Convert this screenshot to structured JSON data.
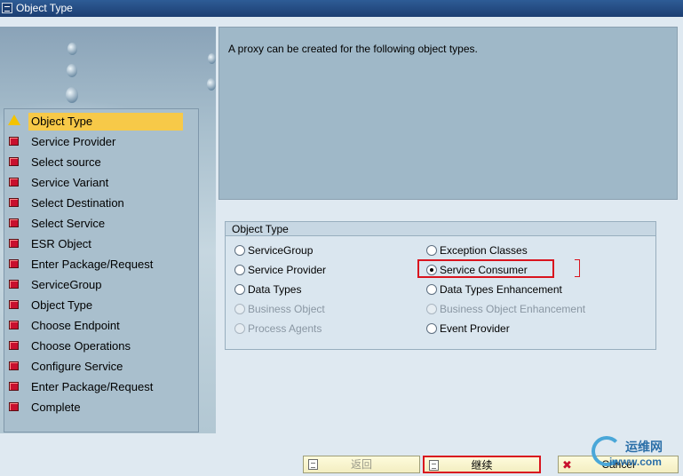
{
  "window": {
    "title": "Object Type"
  },
  "steps": [
    {
      "label": "Object Type",
      "status": "warning",
      "active": true
    },
    {
      "label": "Service Provider",
      "status": "error"
    },
    {
      "label": "Select source",
      "status": "error"
    },
    {
      "label": "Service Variant",
      "status": "error"
    },
    {
      "label": "Select Destination",
      "status": "error"
    },
    {
      "label": "Select Service",
      "status": "error"
    },
    {
      "label": "ESR Object",
      "status": "error"
    },
    {
      "label": "Enter Package/Request",
      "status": "error"
    },
    {
      "label": "ServiceGroup",
      "status": "error"
    },
    {
      "label": "Object Type",
      "status": "error"
    },
    {
      "label": "Choose Endpoint",
      "status": "error"
    },
    {
      "label": "Choose Operations",
      "status": "error"
    },
    {
      "label": "Configure Service",
      "status": "error"
    },
    {
      "label": "Enter Package/Request",
      "status": "error"
    },
    {
      "label": "Complete",
      "status": "error"
    }
  ],
  "info": {
    "text": "A proxy can be created for the following object types."
  },
  "group": {
    "title": "Object Type",
    "options_left": [
      {
        "label": "ServiceGroup",
        "selected": false,
        "enabled": true
      },
      {
        "label": "Service Provider",
        "selected": false,
        "enabled": true
      },
      {
        "label": "Data Types",
        "selected": false,
        "enabled": true
      },
      {
        "label": "Business Object",
        "selected": false,
        "enabled": false
      },
      {
        "label": "Process Agents",
        "selected": false,
        "enabled": false
      }
    ],
    "options_right": [
      {
        "label": "Exception Classes",
        "selected": false,
        "enabled": true
      },
      {
        "label": "Service Consumer",
        "selected": true,
        "enabled": true
      },
      {
        "label": "Data Types Enhancement",
        "selected": false,
        "enabled": true
      },
      {
        "label": "Business Object Enhancement",
        "selected": false,
        "enabled": false
      },
      {
        "label": "Event Provider",
        "selected": false,
        "enabled": true
      }
    ]
  },
  "buttons": {
    "back": "返回",
    "next": "继续",
    "cancel": "Cancel"
  },
  "watermark": {
    "line1": "运维网",
    "line2": "iwww.com"
  },
  "colors": {
    "highlight": "#d9141e",
    "active_step": "#f7c948"
  }
}
